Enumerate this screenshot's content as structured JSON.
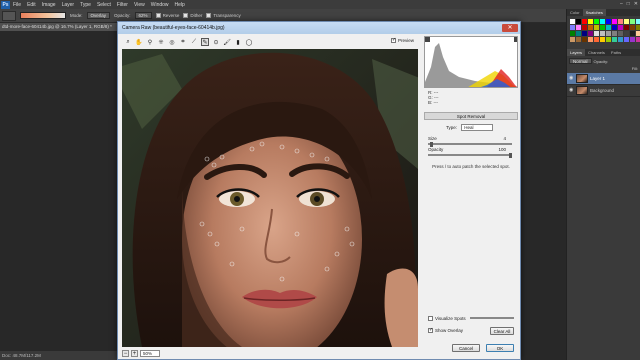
{
  "menubar": {
    "logo": "Ps",
    "items": [
      "File",
      "Edit",
      "Image",
      "Layer",
      "Type",
      "Select",
      "Filter",
      "View",
      "Window",
      "Help"
    ],
    "controls": [
      "–",
      "□",
      "✕"
    ]
  },
  "options": {
    "mode_label": "Mode:",
    "mode_value": "Overlay",
    "opacity_label": "Opacity:",
    "opacity_value": "62%",
    "reverse_label": "Reverse",
    "dither_label": "Dither",
    "transparency_label": "Transparency"
  },
  "document": {
    "tab_title": "dtd-more-face-60414b.jpg @ 16.7% (Layer 1, RGB/8) *",
    "status": "Doc: 48.7M/117.2M"
  },
  "dialog": {
    "title": "Camera Raw (beautiful-eyes-face-60414b.jpg)",
    "close_label": "✕",
    "preview_label": "Preview",
    "zoom_value": "50%",
    "rgb_readout": [
      "R: ---",
      "G: ---",
      "B: ---"
    ],
    "spot_removal_header": "Spot Removal",
    "type_label": "Type:",
    "type_value": "Heal",
    "size_label": "Size",
    "size_value": "4",
    "opacity_label": "Opacity",
    "opacity_value": "100",
    "hint": "Press / to auto patch the selected spot.",
    "visualize_spots_label": "Visualize Spots",
    "show_overlay_label": "Show Overlay",
    "clear_all_label": "Clear All",
    "cancel_label": "Cancel",
    "ok_label": "OK",
    "tools": [
      {
        "name": "zoom-tool-icon",
        "glyph": "⌕"
      },
      {
        "name": "hand-tool-icon",
        "glyph": "✋"
      },
      {
        "name": "white-balance-icon",
        "glyph": "⚲"
      },
      {
        "name": "color-sampler-icon",
        "glyph": "⁜"
      },
      {
        "name": "targeted-adjustment-icon",
        "glyph": "◎"
      },
      {
        "name": "crop-tool-icon",
        "glyph": "⌗"
      },
      {
        "name": "straighten-tool-icon",
        "glyph": "⟋"
      },
      {
        "name": "spot-removal-icon",
        "glyph": "✎"
      },
      {
        "name": "red-eye-icon",
        "glyph": "⊙"
      },
      {
        "name": "adjustment-brush-icon",
        "glyph": "🖌"
      },
      {
        "name": "graduated-filter-icon",
        "glyph": "▮"
      },
      {
        "name": "radial-filter-icon",
        "glyph": "◯"
      }
    ]
  },
  "panels": {
    "top_tabs": [
      "Color",
      "Swatches"
    ],
    "layer_tabs": [
      "Layers",
      "Channels",
      "Paths"
    ],
    "blend_mode": "Normal",
    "opacity_label": "Opacity:",
    "fill_label": "Fill:",
    "layers": [
      {
        "name": "Layer 1",
        "selected": true
      },
      {
        "name": "Background",
        "selected": false
      }
    ],
    "swatch_colors": [
      "#ffffff",
      "#000000",
      "#ff0000",
      "#ffff00",
      "#00ff00",
      "#00ffff",
      "#0000ff",
      "#ff00ff",
      "#ff8080",
      "#ffff80",
      "#80ff80",
      "#80ffff",
      "#8080ff",
      "#ff80ff",
      "#c00000",
      "#c06000",
      "#c0c000",
      "#00c000",
      "#00c0c0",
      "#0000c0",
      "#c000c0",
      "#800000",
      "#804000",
      "#808000",
      "#008000",
      "#008080",
      "#000080",
      "#800080",
      "#e0e0e0",
      "#c0c0c0",
      "#a0a0a0",
      "#808080",
      "#606060",
      "#404040",
      "#202020",
      "#ffcc99",
      "#cc9966",
      "#996633",
      "#663300",
      "#ff9966",
      "#ff6633",
      "#ffcc00",
      "#99cc00",
      "#33cc99",
      "#3399cc",
      "#6666ff",
      "#9933cc",
      "#cc3399"
    ]
  }
}
